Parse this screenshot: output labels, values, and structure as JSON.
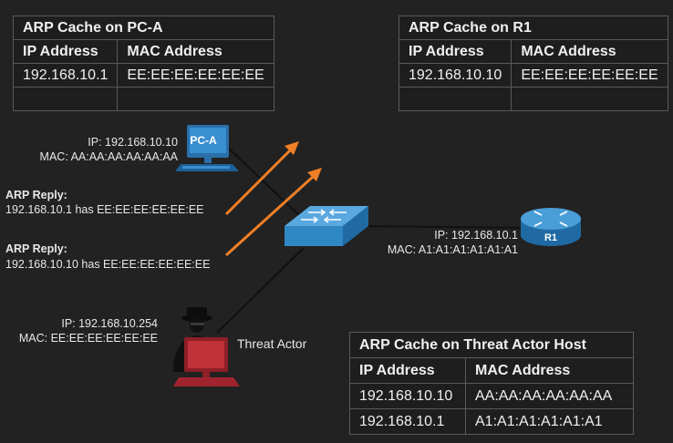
{
  "tables": {
    "pca": {
      "title": "ARP Cache on PC-A",
      "col_ip": "IP Address",
      "col_mac": "MAC Address",
      "rows": [
        {
          "ip": "192.168.10.1",
          "mac": "EE:EE:EE:EE:EE:EE"
        },
        {
          "ip": "",
          "mac": ""
        }
      ]
    },
    "r1": {
      "title": "ARP Cache on R1",
      "col_ip": "IP Address",
      "col_mac": "MAC Address",
      "rows": [
        {
          "ip": "192.168.10.10",
          "mac": "EE:EE:EE:EE:EE:EE"
        },
        {
          "ip": "",
          "mac": ""
        }
      ]
    },
    "threat": {
      "title": "ARP Cache on Threat Actor Host",
      "col_ip": "IP Address",
      "col_mac": "MAC Address",
      "rows": [
        {
          "ip": "192.168.10.10",
          "mac": "AA:AA:AA:AA:AA:AA"
        },
        {
          "ip": "192.168.10.1",
          "mac": "A1:A1:A1:A1:A1:A1"
        }
      ]
    }
  },
  "devices": {
    "pca": {
      "name": "PC-A",
      "ip": "IP: 192.168.10.10",
      "mac": "MAC: AA:AA:AA:AA:AA:AA"
    },
    "r1": {
      "name": "R1",
      "ip": "IP: 192.168.10.1",
      "mac": "MAC: A1:A1:A1:A1:A1:A1"
    },
    "threat": {
      "name": "Threat Actor",
      "ip": "IP: 192.168.10.254",
      "mac": "MAC: EE:EE:EE:EE:EE:EE"
    }
  },
  "arp_replies": [
    {
      "heading": "ARP Reply:",
      "text": "192.168.10.1 has EE:EE:EE:EE:EE:EE"
    },
    {
      "heading": "ARP Reply:",
      "text": "192.168.10.10 has EE:EE:EE:EE:EE:EE"
    }
  ],
  "colors": {
    "background": "#222222",
    "arrow": "#f07f26",
    "switch": "#2f87c4",
    "router": "#2c7fbf",
    "pc": "#3a8fd0",
    "threat_pc": "#c0313a"
  }
}
